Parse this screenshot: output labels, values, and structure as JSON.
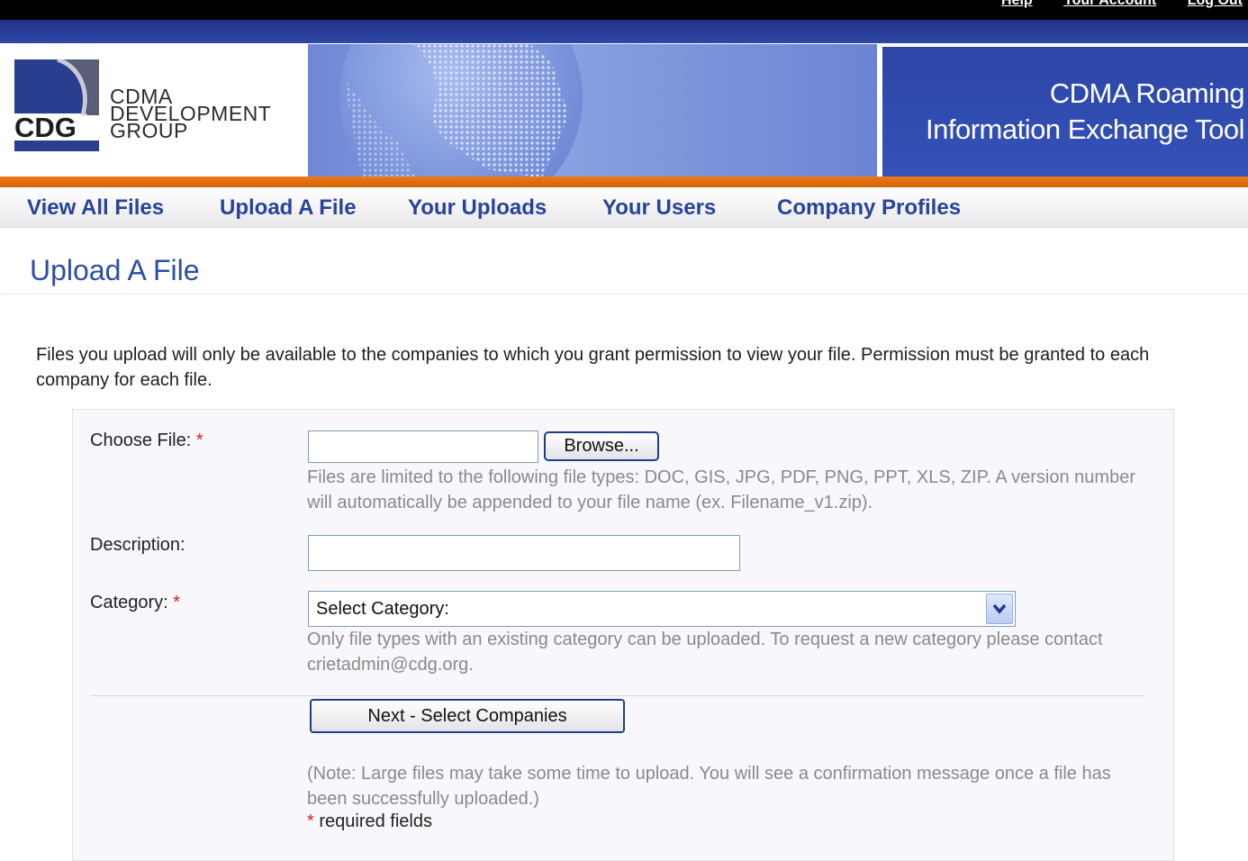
{
  "top_links": [
    "Help",
    "Your Account",
    "Log Out"
  ],
  "logo": {
    "abbr": "CDG",
    "line1": "CDMA",
    "line2": "DEVELOPMENT",
    "line3": "GROUP"
  },
  "header": {
    "title_line1": "CDMA Roaming",
    "title_line2": "Information Exchange Tool"
  },
  "nav": {
    "items": [
      {
        "label": "View All Files"
      },
      {
        "label": "Upload A File"
      },
      {
        "label": "Your Uploads"
      },
      {
        "label": "Your Users"
      },
      {
        "label": "Company Profiles"
      }
    ]
  },
  "page": {
    "title": "Upload A File",
    "intro": "Files you upload will only be available to the companies to which you grant permission to view your file. Permission must be granted to each company for each file."
  },
  "form": {
    "choose_file_label": "Choose File:",
    "browse_label": "Browse...",
    "file_help": "Files are limited to the following file types: DOC, GIS, JPG, PDF, PNG, PPT, XLS, ZIP. A version number will automatically be appended to your file name (ex. Filename_v1.zip).",
    "description_label": "Description:",
    "description_value": "",
    "category_label": "Category:",
    "category_selected": "Select Category:",
    "category_help": "Only file types with an existing category can be uploaded. To request a new category please contact crietadmin@cdg.org.",
    "next_button": "Next - Select Companies",
    "note": "(Note: Large files may take some time to upload. You will see a confirmation message once a file has been successfully uploaded.)",
    "required_star": "*",
    "required_text": "required fields"
  },
  "colors": {
    "brand_blue": "#27439c",
    "accent_orange": "#f07a16",
    "required_red": "#e41a1a"
  }
}
